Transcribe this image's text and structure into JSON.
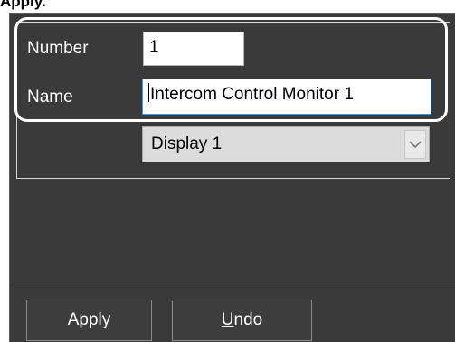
{
  "heading": "Apply.",
  "form": {
    "number_label": "Number",
    "number_value": "1",
    "name_label": "Name",
    "name_value": "Intercom Control Monitor 1",
    "display_select_value": "Display 1"
  },
  "buttons": {
    "apply_label": "Apply",
    "undo_label": "Undo"
  },
  "icons": {
    "dropdown": "chevron-down-icon"
  },
  "colors": {
    "panel_bg": "#3a3a3a",
    "focus_border": "#3399ff",
    "callout": "#ffffff"
  }
}
